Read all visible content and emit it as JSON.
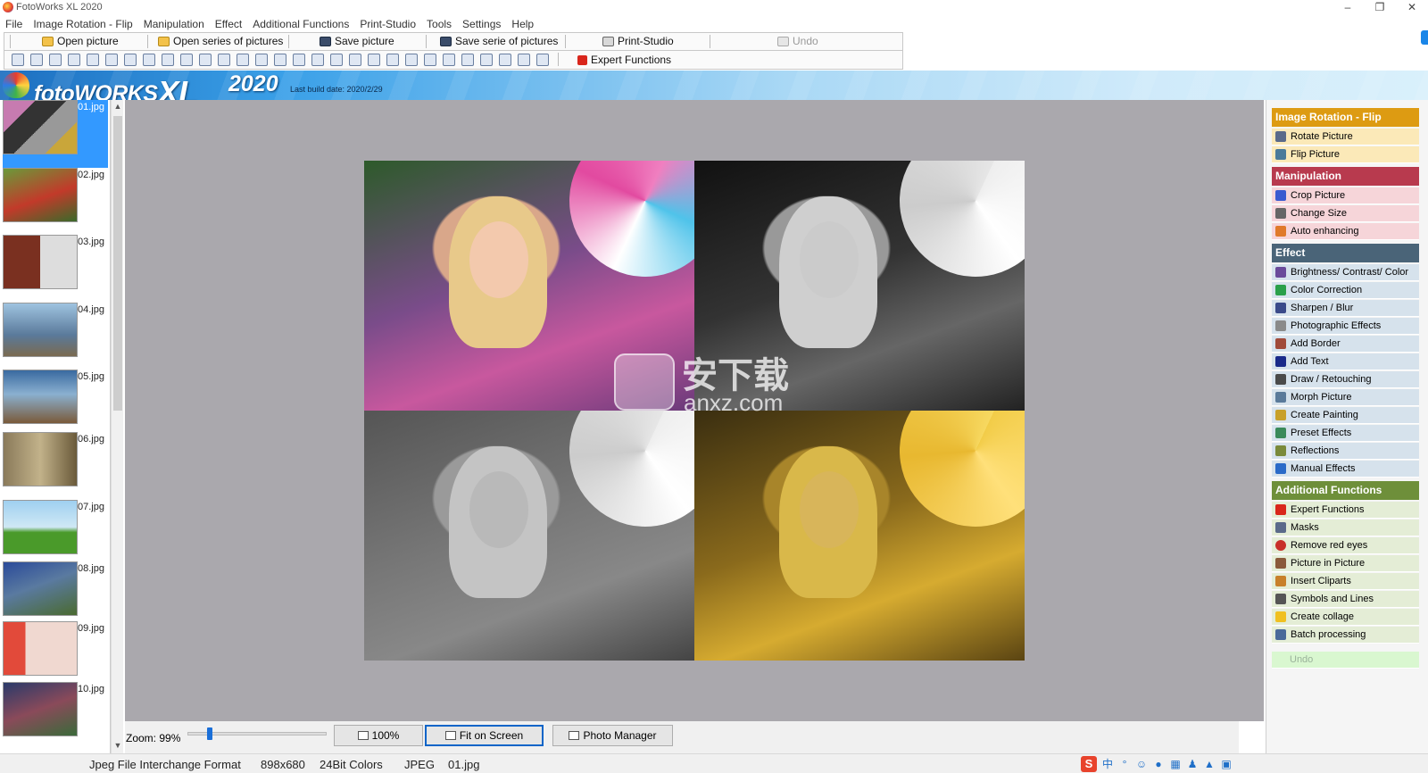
{
  "window": {
    "title": "FotoWorks XL 2020",
    "minimize": "–",
    "restore": "❐",
    "close": "✕"
  },
  "menu": [
    "File",
    "Image Rotation - Flip",
    "Manipulation",
    "Effect",
    "Additional Functions",
    "Print-Studio",
    "Tools",
    "Settings",
    "Help"
  ],
  "toolbar": {
    "open_picture": "Open picture",
    "open_series": "Open series of pictures",
    "save_picture": "Save picture",
    "save_series": "Save serie of pictures",
    "print_studio": "Print-Studio",
    "undo": "Undo",
    "expert_functions": "Expert Functions"
  },
  "banner": {
    "logo_foto": "foto",
    "logo_works": "WORKS",
    "logo_xl": "XL",
    "year": "2020",
    "build": "Last build date: 2020/2/29"
  },
  "thumbnails": [
    {
      "name": "01.jpg",
      "selected": true
    },
    {
      "name": "02.jpg",
      "selected": false
    },
    {
      "name": "03.jpg",
      "selected": false
    },
    {
      "name": "04.jpg",
      "selected": false
    },
    {
      "name": "05.jpg",
      "selected": false
    },
    {
      "name": "06.jpg",
      "selected": false
    },
    {
      "name": "07.jpg",
      "selected": false
    },
    {
      "name": "08.jpg",
      "selected": false
    },
    {
      "name": "09.jpg",
      "selected": false
    },
    {
      "name": "10.jpg",
      "selected": false
    }
  ],
  "watermark": {
    "cn": "安下载",
    "en": "anxz.com"
  },
  "zoom": {
    "label": "Zoom: 99%",
    "level": 0.99,
    "btn_100": "100%",
    "btn_fit": "Fit on Screen",
    "btn_manager": "Photo Manager"
  },
  "panel": {
    "rotation": {
      "title": "Image Rotation - Flip",
      "color": "#dd9b12",
      "item_bg": "#fbe9b8",
      "items": [
        "Rotate Picture",
        "Flip Picture"
      ]
    },
    "manipulation": {
      "title": "Manipulation",
      "color": "#b83a4e",
      "item_bg": "#f6d5d9",
      "items": [
        "Crop Picture",
        "Change Size",
        "Auto enhancing"
      ]
    },
    "effect": {
      "title": "Effect",
      "color": "#4a6478",
      "item_bg": "#d6e2ec",
      "items": [
        "Brightness/ Contrast/ Color",
        "Color Correction",
        "Sharpen / Blur",
        "Photographic Effects",
        "Add Border",
        "Add Text",
        "Draw / Retouching",
        "Morph Picture",
        "Create Painting",
        "Preset Effects",
        "Reflections",
        "Manual Effects"
      ]
    },
    "additional": {
      "title": "Additional Functions",
      "color": "#6e8f3a",
      "item_bg": "#e4edd6",
      "items": [
        "Expert Functions",
        "Masks",
        "Remove red eyes",
        "Picture in Picture",
        "Insert Cliparts",
        "Symbols and Lines",
        "Create collage",
        "Batch processing"
      ]
    },
    "undo": "Undo"
  },
  "status": {
    "format": "Jpeg File Interchange Format",
    "dimensions": "898x680",
    "colors": "24Bit Colors",
    "type": "JPEG",
    "file": "01.jpg"
  },
  "tray": {
    "ime": "S",
    "lang": "中"
  }
}
